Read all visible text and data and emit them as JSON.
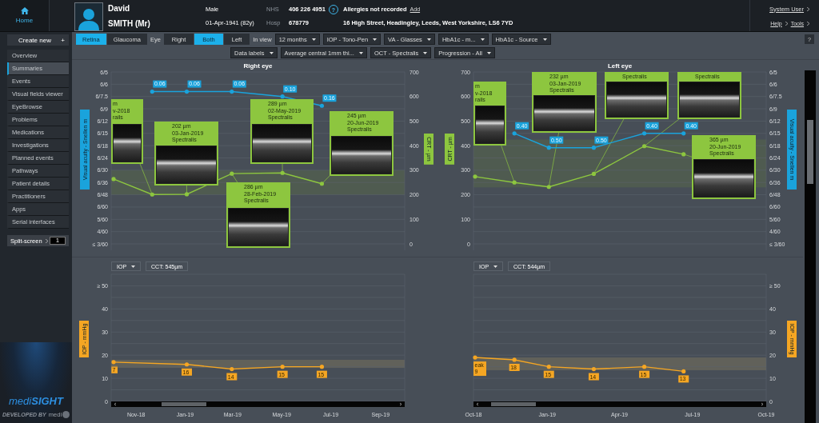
{
  "header": {
    "home": "Home",
    "first_name": "David",
    "surname": "SMITH (Mr)",
    "sex": "Male",
    "dob": "01-Apr-1941 (82y)",
    "ids": [
      {
        "label": "NHS",
        "value": "406 226 4951"
      },
      {
        "label": "Hosp",
        "value": "678779"
      }
    ],
    "help": "?",
    "allergies": "Allergies not recorded",
    "allergies_action": "Add",
    "address": "16 High Street, Headingley, Leeds, West Yorkshire, LS6 7YD",
    "user": "System User",
    "links": [
      "Help",
      "Tools"
    ]
  },
  "sidebar": {
    "create": "Create new",
    "create_icon": "+",
    "items": [
      {
        "label": "Overview",
        "selected": false
      },
      {
        "label": "Summaries",
        "selected": true
      },
      {
        "label": "Events",
        "selected": false
      },
      {
        "label": "Visual fields viewer",
        "selected": false
      },
      {
        "label": "EyeBrowse",
        "selected": false
      },
      {
        "label": "Problems",
        "selected": false
      },
      {
        "label": "Medications",
        "selected": false
      },
      {
        "label": "Investigations",
        "selected": false
      },
      {
        "label": "Planned events",
        "selected": false
      },
      {
        "label": "Pathways",
        "selected": false
      },
      {
        "label": "Patient details",
        "selected": false
      },
      {
        "label": "Practitioners",
        "selected": false
      },
      {
        "label": "Apps",
        "selected": false
      },
      {
        "label": "Serial interfaces",
        "selected": false
      }
    ],
    "split": {
      "label": "Split-screen",
      "value": "1"
    },
    "logo": {
      "brand_a": "medi",
      "brand_b": "SIGHT",
      "developer": "DEVELOPED BY",
      "developer_brand": "medi"
    }
  },
  "toolbar": {
    "mode_tabs": [
      {
        "label": "Retina",
        "selected": true
      },
      {
        "label": "Glaucoma",
        "selected": false
      }
    ],
    "eye_label": "Eye",
    "eye_tabs": [
      {
        "label": "Right",
        "selected": false
      },
      {
        "label": "Both",
        "selected": true
      },
      {
        "label": "Left",
        "selected": false
      }
    ],
    "in_view_label": "In view",
    "row1_selects": [
      "12 months",
      "IOP - Tono-Pen",
      "VA - Glasses",
      "HbA1c - m...",
      "HbA1c - Source"
    ],
    "row2_selects": [
      "Data labels",
      "Average central 1mm thi...",
      "OCT - Spectralis",
      "Progression - All"
    ],
    "help": "?"
  },
  "eyes": [
    {
      "title": "Right eye",
      "va": {
        "label": "Visual acuity - Snellen m",
        "ticks": [
          "6/5",
          "6/6",
          "6/7.5",
          "6/9",
          "6/12",
          "6/15",
          "6/18",
          "6/24",
          "6/30",
          "6/36",
          "6/48",
          "6/60",
          "5/60",
          "4/60",
          "≤ 3/60"
        ],
        "readings": [
          "0.06",
          "0.06",
          "0.06",
          "0.10",
          "0.16"
        ]
      },
      "chart_data": {
        "type": "line",
        "grid": true,
        "ylabel": "CRT - µm",
        "x": [
          "2018-10-04",
          "2018-11-21",
          "2019-01-03",
          "2019-02-28",
          "2019-05-02",
          "2019-06-20"
        ],
        "xlim": [
          "2018-10-01",
          "2019-10-01"
        ],
        "ylim": [
          0,
          700
        ],
        "yticks": [
          0,
          100,
          200,
          300,
          400,
          500,
          600,
          700
        ],
        "series": [
          {
            "color": "#8dc63f",
            "values": [
              264,
              201,
              202,
              286,
              289,
              245
            ]
          }
        ]
      },
      "scans": [
        {
          "lines": [
            "m",
            "v-2018",
            "rails"
          ]
        },
        {
          "lines": [
            "202 µm",
            "03-Jan-2019",
            "Spectralis"
          ]
        },
        {
          "lines": [
            "286 µm",
            "28-Feb-2019",
            "Spectralis"
          ]
        },
        {
          "lines": [
            "289 µm",
            "02-May-2019",
            "Spectralis"
          ]
        },
        {
          "lines": [
            "245 µm",
            "20-Jun-2019",
            "Spectralis"
          ]
        }
      ],
      "iop": {
        "selector": "IOP",
        "cct": "CCT: 545µm",
        "cut_label": "7",
        "chart_data": {
          "type": "line",
          "grid": true,
          "ylabel": "IOP - mmHg",
          "x": [
            "2018-10-04",
            "2019-01-03",
            "2019-02-28",
            "2019-05-02",
            "2019-06-20"
          ],
          "xlim": [
            "2018-10-01",
            "2019-10-01"
          ],
          "ylim": [
            0,
            55
          ],
          "xticks": [
            {
              "value": "2018-11-01",
              "label": "Nov-18"
            },
            {
              "value": "2019-01-01",
              "label": "Jan-19"
            },
            {
              "value": "2019-03-01",
              "label": "Mar-19"
            },
            {
              "value": "2019-05-01",
              "label": "May-19"
            },
            {
              "value": "2019-07-01",
              "label": "Jul-19"
            },
            {
              "value": "2019-09-01",
              "label": "Sep-19"
            }
          ],
          "yticks": [
            {
              "value": 0,
              "label": "0"
            },
            {
              "value": 10,
              "label": "10"
            },
            {
              "value": 20,
              "label": "20"
            },
            {
              "value": 30,
              "label": "30"
            },
            {
              "value": 40,
              "label": "40"
            },
            {
              "value": 50,
              "label": "≥ 50"
            }
          ],
          "series": [
            {
              "color": "#f5a623",
              "values": [
                17,
                16,
                14,
                15,
                15
              ],
              "value_labels": [
                null,
                "16",
                "14",
                "15",
                "15"
              ]
            }
          ]
        }
      }
    },
    {
      "title": "Left eye",
      "va": {
        "label": "Visual acuity - Snellen m",
        "ticks": [
          "6/5",
          "6/6",
          "6/7.5",
          "6/9",
          "6/12",
          "6/15",
          "6/18",
          "6/24",
          "6/30",
          "6/36",
          "6/48",
          "6/60",
          "5/60",
          "4/60",
          "≤ 3/60"
        ],
        "readings": [
          "0.40",
          "0.50",
          "0.50",
          "0.40",
          "0.40"
        ]
      },
      "chart_data": {
        "type": "line",
        "grid": true,
        "ylabel": "CRT - µm",
        "x": [
          "2018-10-03",
          "2018-11-21",
          "2019-01-03",
          "2019-02-28",
          "2019-05-02",
          "2019-06-20"
        ],
        "xlim": [
          "2018-10-01",
          "2019-10-01"
        ],
        "ylim": [
          0,
          700
        ],
        "yticks": [
          0,
          100,
          200,
          300,
          400,
          500,
          600,
          700
        ],
        "series": [
          {
            "color": "#8dc63f",
            "values": [
              274,
              250,
              232,
              285,
              398,
              365
            ]
          }
        ]
      },
      "scans": [
        {
          "lines": [
            "m",
            "v-2018",
            "rails"
          ]
        },
        {
          "lines": [
            "232 µm",
            "03-Jan-2019",
            "Spectralis"
          ]
        },
        {
          "lines": [
            "Spectralis"
          ]
        },
        {
          "lines": [
            "Spectralis"
          ]
        },
        {
          "lines": [
            "365 µm",
            "20-Jun-2019",
            "Spectralis"
          ]
        }
      ],
      "iop": {
        "selector": "IOP",
        "cct": "CCT: 544µm",
        "chart_data": {
          "type": "line",
          "grid": true,
          "ylabel": "IOP - mmHg",
          "x": [
            "2018-10-03",
            "2018-11-21",
            "2019-01-03",
            "2019-02-28",
            "2019-05-02",
            "2019-06-20"
          ],
          "xlim": [
            "2018-10-01",
            "2019-10-01"
          ],
          "ylim": [
            0,
            55
          ],
          "xticks": [
            {
              "value": "2018-10-01",
              "label": "Oct-18"
            },
            {
              "value": "2019-01-01",
              "label": "Jan-19"
            },
            {
              "value": "2019-04-01",
              "label": "Apr-19"
            },
            {
              "value": "2019-07-01",
              "label": "Jul-19"
            },
            {
              "value": "2019-10-01",
              "label": "Oct-19"
            }
          ],
          "yticks": [
            {
              "value": 0,
              "label": "0"
            },
            {
              "value": 10,
              "label": "10"
            },
            {
              "value": 20,
              "label": "20"
            },
            {
              "value": 30,
              "label": "30"
            },
            {
              "value": 40,
              "label": "40"
            },
            {
              "value": 50,
              "label": "≥ 50"
            }
          ],
          "series": [
            {
              "color": "#f5a623",
              "values": [
                19,
                18,
                15,
                14,
                15,
                13
              ],
              "value_labels": [
                "eak 9",
                "18",
                "15",
                "14",
                "15",
                "13"
              ]
            }
          ]
        }
      }
    }
  ]
}
